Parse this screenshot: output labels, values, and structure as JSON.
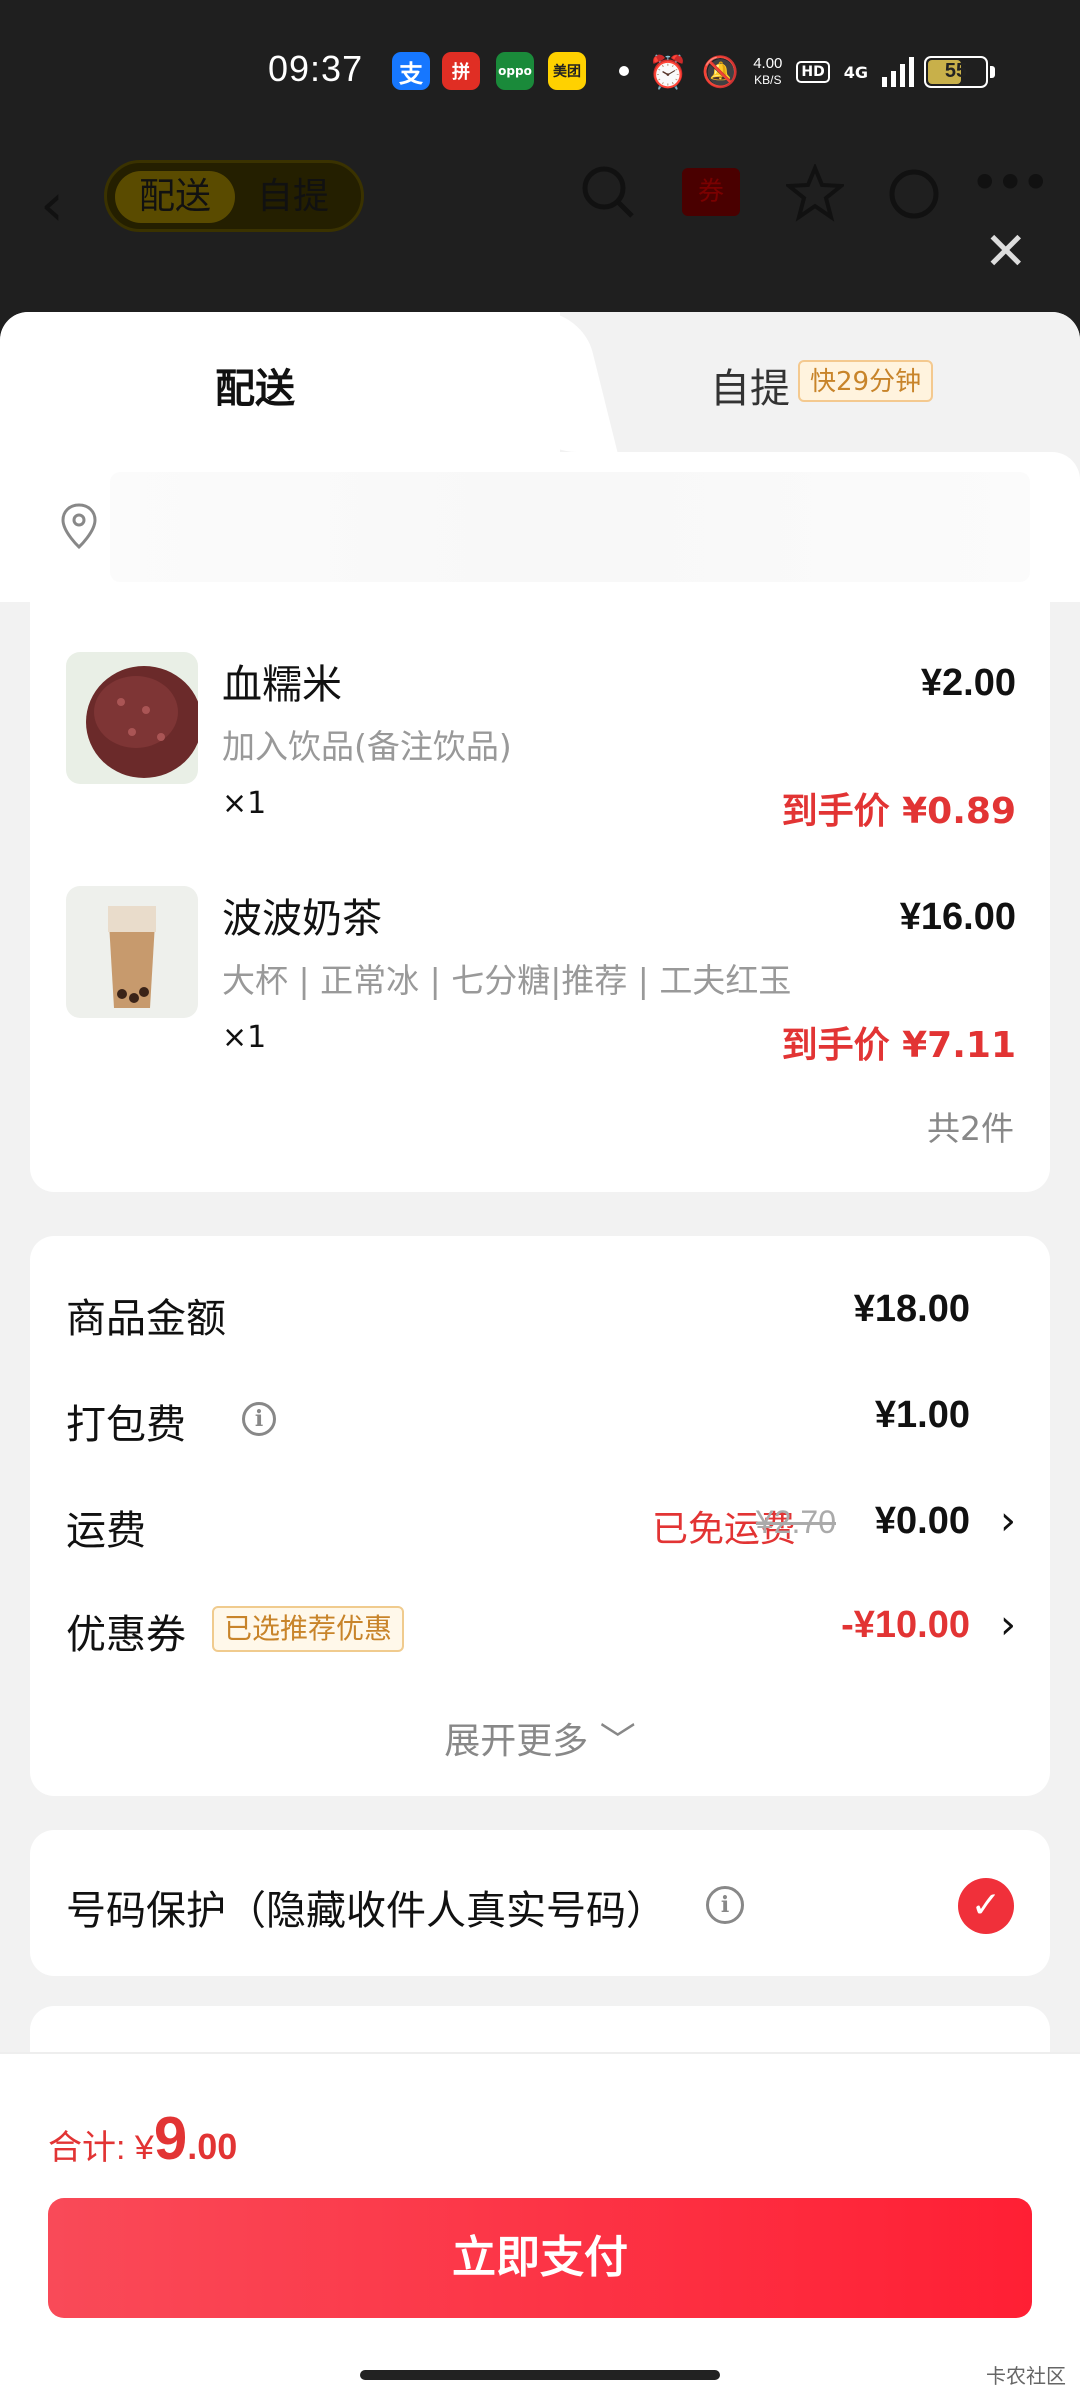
{
  "status_bar": {
    "time": "09:37",
    "apps": [
      {
        "name": "alipay-app-icon",
        "label": "支",
        "color": "#1677ff"
      },
      {
        "name": "pinduoduo-app-icon",
        "label": "拼",
        "color": "#e02e24"
      },
      {
        "name": "oppo-app-icon",
        "label": "oppo",
        "color": "#1a8a3a"
      },
      {
        "name": "meituan-app-icon",
        "label": "美团",
        "color": "#ffd100"
      }
    ],
    "net_speed_value": "4.00",
    "net_speed_unit": "KB/S",
    "hd": "HD",
    "network": "4G",
    "battery": "55"
  },
  "header": {
    "toggle_on": "配送",
    "toggle_off": "自提",
    "coupon_icon_label": "券"
  },
  "sheet": {
    "tab_delivery": "配送",
    "tab_pickup": "自提",
    "tab_pickup_badge": "快29分钟"
  },
  "items": [
    {
      "name": "血糯米",
      "spec": "加入饮品(备注饮品)",
      "qty": "×1",
      "price": "¥2.00",
      "final": "到手价 ¥0.89"
    },
    {
      "name": "波波奶茶",
      "spec": "大杯 | 正常冰 | 七分糖|推荐 | 工夫红玉",
      "qty": "×1",
      "price": "¥16.00",
      "final": "到手价 ¥7.11"
    }
  ],
  "items_count": "共2件",
  "summary": {
    "goods_label": "商品金额",
    "goods_value": "¥18.00",
    "packing_label": "打包费",
    "packing_value": "¥1.00",
    "shipping_label": "运费",
    "shipping_free": "已免运费",
    "shipping_original": "¥2.70",
    "shipping_value": "¥0.00",
    "coupon_label": "优惠券",
    "coupon_tag": "已选推荐优惠",
    "coupon_value": "-¥10.00",
    "expand": "展开更多 ﹀"
  },
  "privacy": {
    "label": "号码保护（隐藏收件人真实号码）",
    "checked": true
  },
  "bottom": {
    "total_label": "合计: ",
    "total_currency": "¥",
    "total_int": "9",
    "total_dec": ".00",
    "pay_button": "立即支付"
  },
  "watermark": "卡农社区"
}
